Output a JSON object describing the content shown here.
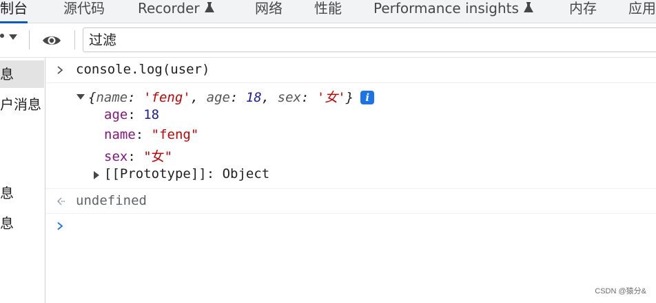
{
  "tabs": [
    {
      "label": "控制台",
      "active": true
    },
    {
      "label": "源代码"
    },
    {
      "label": "Recorder",
      "icon": "flask-icon"
    },
    {
      "label": "网络"
    },
    {
      "label": "性能"
    },
    {
      "label": "Performance insights",
      "icon": "flask-icon"
    },
    {
      "label": "内存"
    },
    {
      "label": "应用"
    }
  ],
  "toolbar": {
    "context_icon": "chevron-down-icon",
    "live_expression_icon": "eye-icon",
    "filter_placeholder": "过滤"
  },
  "sidebar": {
    "items": [
      {
        "label": "信息",
        "selected": true
      },
      {
        "label": "用户消息"
      },
      {
        "label": "信息"
      },
      {
        "label": "消息"
      }
    ]
  },
  "console": {
    "input_command": "console.log(user)",
    "object_preview": {
      "open": "{",
      "name_key": "name",
      "name_value": "'feng'",
      "age_key": "age",
      "age_value": "18",
      "sex_key": "sex",
      "sex_value": "'女'",
      "close": "}"
    },
    "info_badge": "i",
    "properties": [
      {
        "key": "age",
        "value": "18",
        "type": "number"
      },
      {
        "key": "name",
        "value": "\"feng\"",
        "type": "string"
      },
      {
        "key": "sex",
        "value": "\"女\"",
        "type": "string"
      }
    ],
    "prototype_label": "[[Prototype]]",
    "prototype_value": "Object",
    "return_value": "undefined"
  },
  "watermark": "CSDN @猿分&",
  "colors": {
    "accent": "#0b57d0",
    "property_key": "#881280",
    "string_value": "#c80000",
    "number_value": "#1a1aa6",
    "prompt_blue": "#1a73e8"
  }
}
